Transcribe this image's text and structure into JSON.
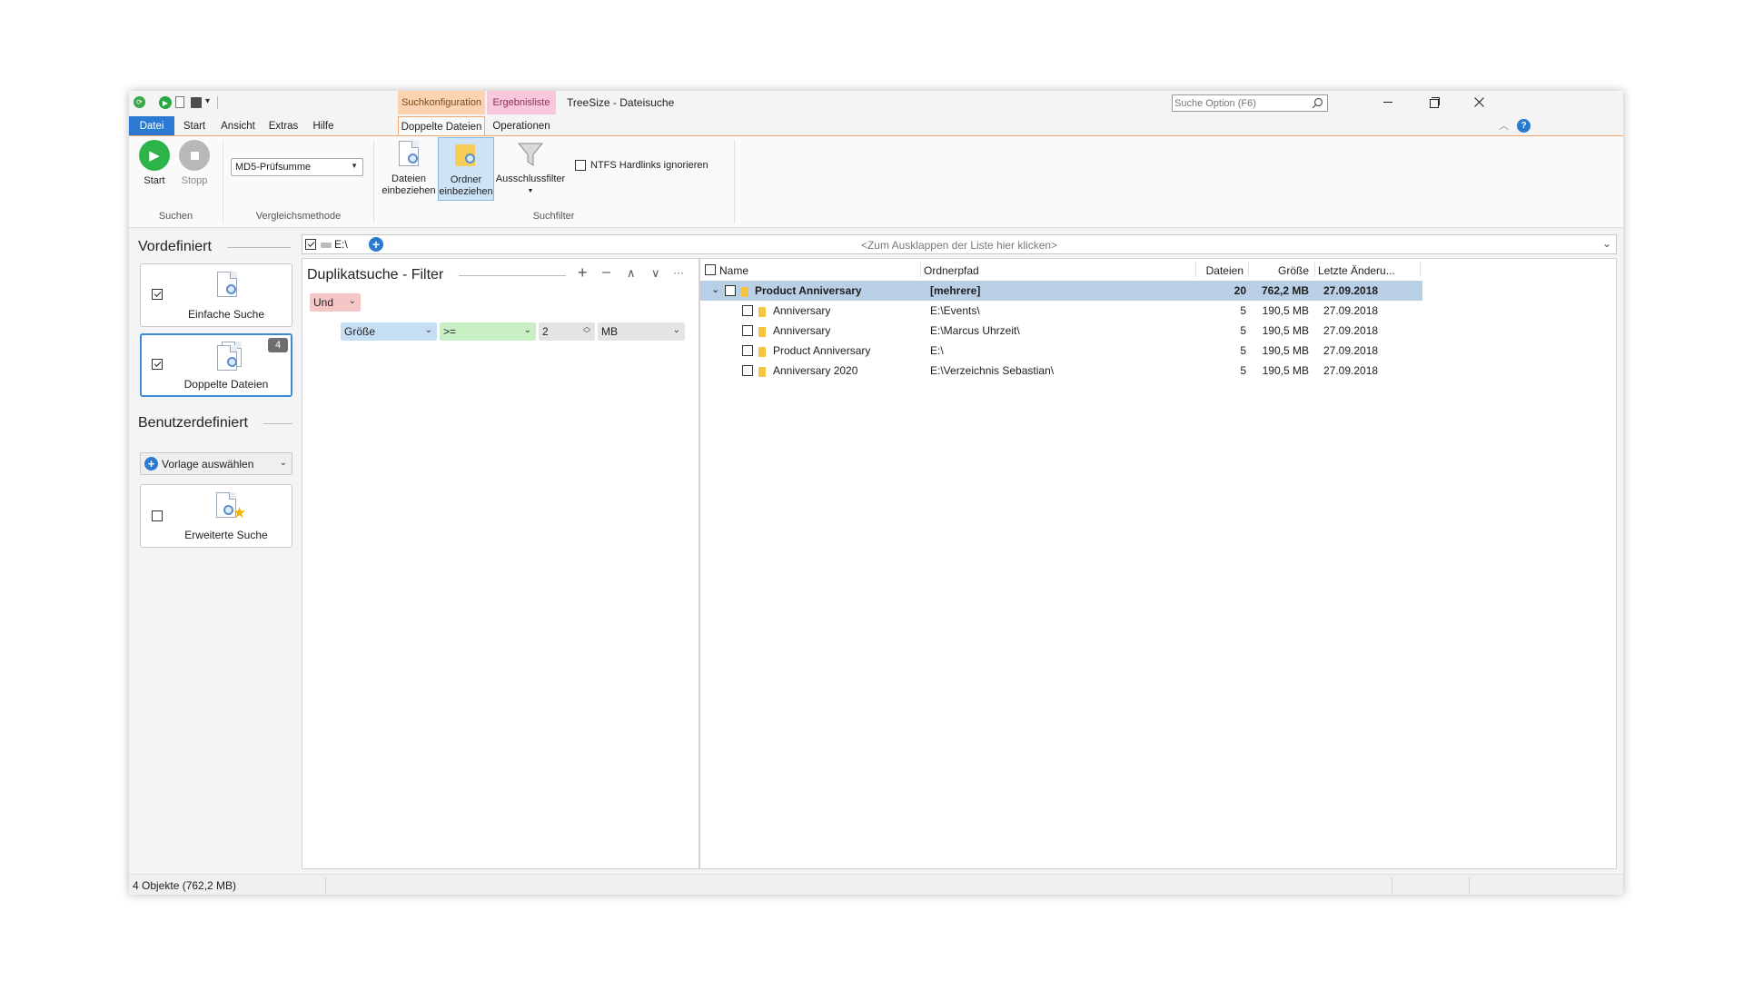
{
  "quick_access": {
    "dropdown_glyph": "▾"
  },
  "context_tabs": {
    "suchkonfiguration": "Suchkonfiguration",
    "ergebnisliste": "Ergebnisliste"
  },
  "window": {
    "title": "TreeSize - Dateisuche"
  },
  "search_option": {
    "placeholder": "Suche Option (F6)"
  },
  "tabs": {
    "datei": "Datei",
    "start": "Start",
    "ansicht": "Ansicht",
    "extras": "Extras",
    "hilfe": "Hilfe",
    "doppelte_dateien": "Doppelte Dateien",
    "operationen": "Operationen"
  },
  "ribbon": {
    "start_label": "Start",
    "stop_label": "Stopp",
    "suchen_group": "Suchen",
    "method_value": "MD5-Prüfsumme",
    "method_group": "Vergleichsmethode",
    "dateien_line1": "Dateien",
    "dateien_line2": "einbeziehen",
    "ordner_line1": "Ordner",
    "ordner_line2": "einbeziehen",
    "ausschluss_label": "Ausschlussfilter",
    "ntfs_label": "NTFS Hardlinks ignorieren",
    "suchfilter_group": "Suchfilter"
  },
  "path_bar": {
    "drive": "E:\\",
    "hint": "<Zum Ausklappen der Liste hier klicken>"
  },
  "sidebar": {
    "vordefiniert": "Vordefiniert",
    "einfache_suche": "Einfache Suche",
    "doppelte_dateien": "Doppelte Dateien",
    "doppelte_badge": "4",
    "benutzerdefiniert": "Benutzerdefiniert",
    "vorlage": "Vorlage auswählen",
    "erweiterte_suche": "Erweiterte Suche"
  },
  "filter": {
    "title": "Duplikatsuche - Filter",
    "add": "+",
    "remove": "–",
    "up": "∧",
    "down": "∨",
    "more": "···",
    "logic": "Und",
    "field": "Größe",
    "operator": ">=",
    "value": "2",
    "unit": "MB"
  },
  "results": {
    "headers": {
      "name": "Name",
      "path": "Ordnerpfad",
      "files": "Dateien",
      "size": "Größe",
      "modified": "Letzte Änderu..."
    },
    "group": {
      "name": "Product Anniversary",
      "path": "[mehrere]",
      "files": "20",
      "size": "762,2 MB",
      "modified": "27.09.2018"
    },
    "rows": [
      {
        "name": "Anniversary",
        "path": "E:\\Events\\",
        "files": "5",
        "size": "190,5 MB",
        "modified": "27.09.2018"
      },
      {
        "name": "Anniversary",
        "path": "E:\\Marcus Uhrzeit\\",
        "files": "5",
        "size": "190,5 MB",
        "modified": "27.09.2018"
      },
      {
        "name": "Product Anniversary",
        "path": "E:\\",
        "files": "5",
        "size": "190,5 MB",
        "modified": "27.09.2018"
      },
      {
        "name": "Anniversary 2020",
        "path": "E:\\Verzeichnis Sebastian\\",
        "files": "5",
        "size": "190,5 MB",
        "modified": "27.09.2018"
      }
    ]
  },
  "status": {
    "text": "4 Objekte (762,2 MB)"
  },
  "colors": {
    "accent": "#2b79d0",
    "suchkonfiguration": "#fbd3b1",
    "ergebnisliste": "#f9c8dc",
    "selected_row": "#b9cfe6",
    "start_green": "#2cb34a",
    "filter_logic": "#f5c6c6",
    "filter_field": "#c6def3",
    "filter_operator": "#c9efc4"
  }
}
